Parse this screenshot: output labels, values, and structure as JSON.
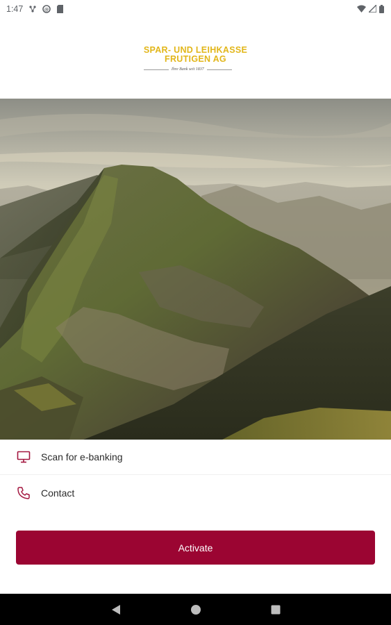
{
  "status_bar": {
    "time": "1:47",
    "left_icons": [
      "data-saver-icon",
      "sync-icon",
      "sd-card-icon"
    ],
    "right_icons": [
      "wifi-icon",
      "signal-icon",
      "battery-icon"
    ]
  },
  "logo": {
    "line1": "SPAR- UND LEIHKASSE",
    "line2": "FRUTIGEN AG",
    "tagline": "Ihre Bank seit 1837",
    "color": "#e2b619"
  },
  "hero": {
    "icon": "mountain-landscape-photo"
  },
  "menu": {
    "items": [
      {
        "label": "Scan for e-banking",
        "icon": "monitor-icon"
      },
      {
        "label": "Contact",
        "icon": "phone-icon"
      }
    ]
  },
  "activate": {
    "label": "Activate",
    "color": "#9b0532"
  },
  "nav": {
    "icons": [
      "back-icon",
      "home-icon",
      "recents-icon"
    ]
  },
  "colors": {
    "accent": "#9b0532",
    "icon_accent": "#a3163f"
  }
}
